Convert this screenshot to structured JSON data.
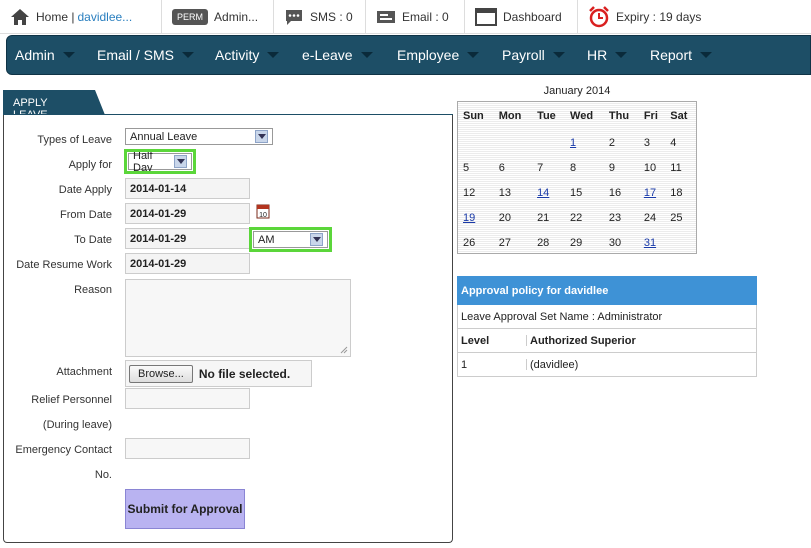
{
  "topbar": {
    "home": "Home |",
    "user": "davidlee...",
    "perm_badge": "PERM",
    "admin": "Admin...",
    "sms": "SMS : 0",
    "email": "Email : 0",
    "dashboard": "Dashboard",
    "expiry": "Expiry : 19 days"
  },
  "nav": [
    "Admin",
    "Email / SMS",
    "Activity",
    "e-Leave",
    "Employee",
    "Payroll",
    "HR",
    "Report"
  ],
  "tab": "APPLY LEAVE",
  "form": {
    "types_label": "Types of Leave",
    "types_value": "Annual Leave",
    "apply_for_label": "Apply for",
    "apply_for_value": "Half Day",
    "date_apply_label": "Date Apply",
    "date_apply_value": "2014-01-14",
    "from_date_label": "From Date",
    "from_date_value": "2014-01-29",
    "to_date_label": "To Date",
    "to_date_value": "2014-01-29",
    "ampm_value": "AM",
    "resume_label": "Date Resume Work",
    "resume_value": "2014-01-29",
    "reason_label": "Reason",
    "attachment_label": "Attachment",
    "browse_label": "Browse...",
    "no_file": "No file selected.",
    "relief_label": "Relief Personnel",
    "during_leave_label": "(During leave)",
    "emergency_label": "Emergency Contact",
    "no_label": "No.",
    "submit_label": "Submit for Approval"
  },
  "calendar": {
    "title": "January 2014",
    "days": [
      "Sun",
      "Mon",
      "Tue",
      "Wed",
      "Thu",
      "Fri",
      "Sat"
    ],
    "weeks": [
      [
        "",
        "",
        "",
        "1",
        "2",
        "3",
        "4"
      ],
      [
        "5",
        "6",
        "7",
        "8",
        "9",
        "10",
        "11"
      ],
      [
        "12",
        "13",
        "14",
        "15",
        "16",
        "17",
        "18"
      ],
      [
        "19",
        "20",
        "21",
        "22",
        "23",
        "24",
        "25"
      ],
      [
        "26",
        "27",
        "28",
        "29",
        "30",
        "31",
        ""
      ]
    ],
    "linked_dates": [
      "1",
      "14",
      "17",
      "19",
      "31"
    ]
  },
  "policy": {
    "title": "Approval policy for davidlee",
    "set_name": "Leave Approval Set Name : Administrator",
    "col_level": "Level",
    "col_superior": "Authorized Superior",
    "rows": [
      {
        "level": "1",
        "superior": "(davidlee)"
      }
    ]
  },
  "colors": {
    "nav": "#1d4e66",
    "highlight": "#5bd63a",
    "policy_header": "#3e92d6",
    "submit": "#b9b3f1"
  }
}
